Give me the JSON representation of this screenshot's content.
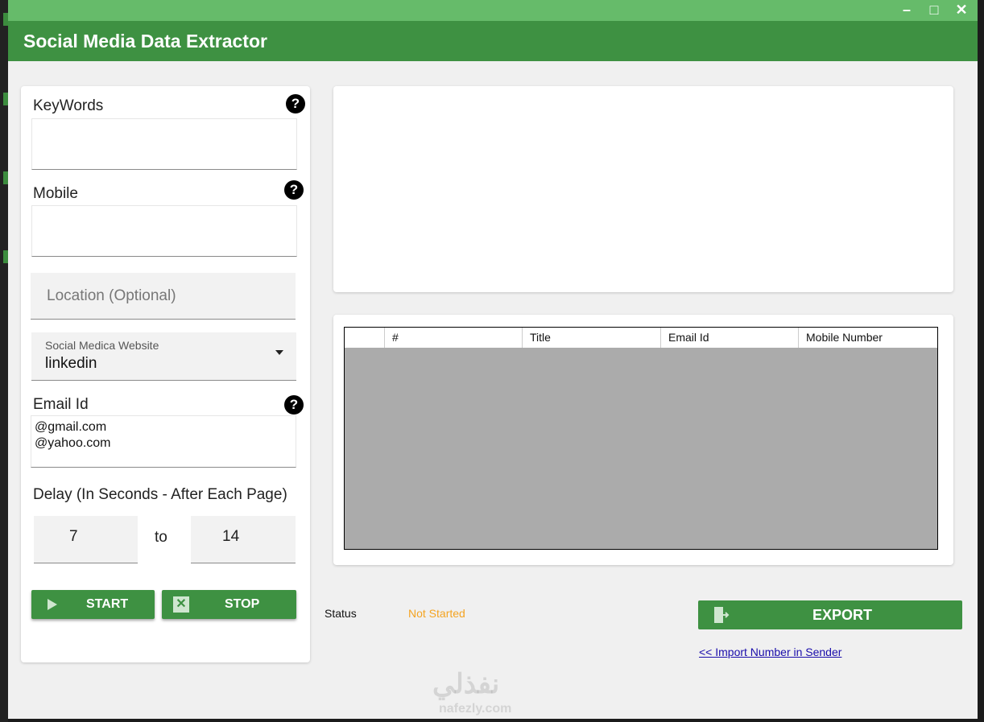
{
  "window": {
    "title": "Social Media Data Extractor",
    "controls": {
      "minimize": "–",
      "maximize": "□",
      "close": "✕"
    }
  },
  "form": {
    "keywords": {
      "label": "KeyWords",
      "value": ""
    },
    "mobile": {
      "label": "Mobile",
      "value": ""
    },
    "location": {
      "placeholder": "Location (Optional)"
    },
    "website": {
      "caption": "Social Medica Website",
      "selected": "linkedin"
    },
    "email": {
      "label": "Email Id",
      "lines": [
        "@gmail.com",
        "@yahoo.com"
      ]
    },
    "delay": {
      "label": "Delay (In Seconds - After Each Page)",
      "from": "7",
      "to_label": "to",
      "to": "14"
    },
    "help_glyph": "?"
  },
  "buttons": {
    "start": "START",
    "stop": "STOP",
    "export": "EXPORT"
  },
  "grid": {
    "columns": [
      "",
      "#",
      "Title",
      "Email Id",
      "Mobile Number"
    ]
  },
  "status": {
    "label": "Status",
    "value": "Not Started"
  },
  "links": {
    "import": "<< Import Number in Sender"
  },
  "watermark": {
    "main": "نفذلي",
    "sub": "nafezly.com"
  },
  "colors": {
    "accent": "#3e9142",
    "titlebar_light": "#66bb6a",
    "status_warning": "#f4a422",
    "link": "#1a0dab"
  }
}
